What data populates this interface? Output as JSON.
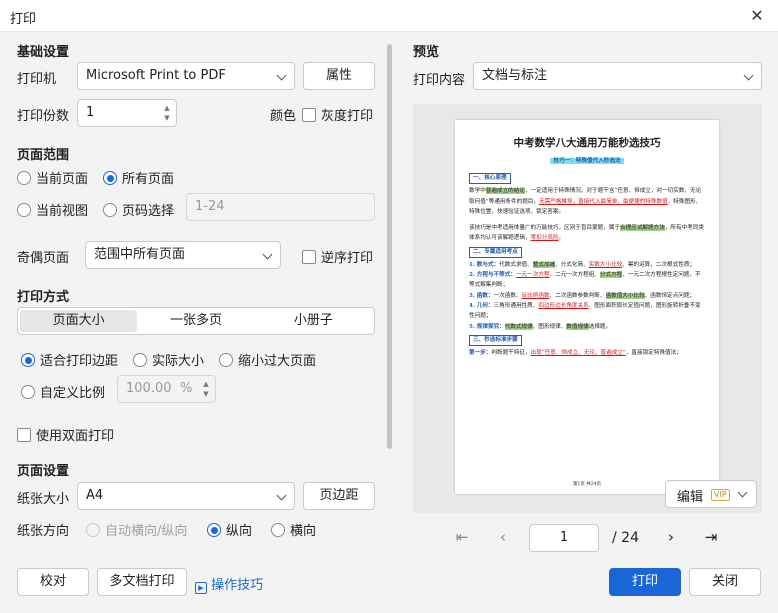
{
  "window": {
    "title": "打印",
    "close_glyph": "✕"
  },
  "basic": {
    "heading": "基础设置",
    "printer_label": "打印机",
    "printer_value": "Microsoft Print to PDF",
    "properties_button": "属性",
    "copies_label": "打印份数",
    "copies_value": "1",
    "color_label": "颜色",
    "grayscale_label": "灰度打印"
  },
  "range": {
    "heading": "页面范围",
    "current_page": "当前页面",
    "all_pages": "所有页面",
    "current_view": "当前视图",
    "page_select": "页码选择",
    "page_select_value": "1-24",
    "odd_even_label": "奇偶页面",
    "odd_even_value": "范围中所有页面",
    "reverse_label": "逆序打印"
  },
  "mode": {
    "heading": "打印方式",
    "tabs": [
      "页面大小",
      "一张多页",
      "小册子"
    ],
    "fit_margin": "适合打印边距",
    "actual_size": "实际大小",
    "shrink_large": "缩小过大页面",
    "custom_scale": "自定义比例",
    "scale_value": "100.00",
    "scale_unit": "%",
    "duplex_label": "使用双面打印"
  },
  "page_setup": {
    "heading": "页面设置",
    "paper_size_label": "纸张大小",
    "paper_size_value": "A4",
    "margins_button": "页边距",
    "orientation_label": "纸张方向",
    "auto_orientation": "自动横向/纵向",
    "portrait": "纵向",
    "landscape": "横向"
  },
  "preview": {
    "heading": "预览",
    "content_label": "打印内容",
    "content_value": "文档与标注",
    "edit_button": "编辑",
    "vip_badge": "VIP",
    "page_current": "1",
    "page_total": "/ 24"
  },
  "doc": {
    "title": "中考数学八大通用万能秒选技巧",
    "subtitle": "技巧一：特殊值代入秒选法",
    "h1": "一、核心原理",
    "p1a": "数学中",
    "p1b": "普遍成立的结论",
    "p1c": "，一定适用于特殊情况。对于题干含“任意、恒成立，对一切实数、无论取何值”等通用条件的题目，",
    "p1d": "无需严格推导，直接代入最简单、最便捷的特殊数值",
    "p1e": "，特殊图形、特殊位置，快速验证选项，锁定答案。",
    "p2a": "该技巧是中考适用体量广的万能技巧，区别于盲目蒙题，属于",
    "p2b": "合理应试解题方法",
    "p2c": "，所有中考同类体系均认可该解题逻辑，",
    "p2d": "零扣分风险",
    "p2e": "。",
    "h2": "二、专属适用考点",
    "l1a": "1. 数与式：",
    "l1b": "代数式求值、",
    "l1c": "整式加减",
    "l1d": "、分式化简、",
    "l1e": "实数大小比较",
    "l1f": "、幂的运算，二次根式性质；",
    "l2a": "2. 方程与不等式：",
    "l2b": "一元一次方程",
    "l2c": "、二元一次方程组、",
    "l2d": "分式方程",
    "l2e": "、一元二次方程根性定问题，不等式解集判断；",
    "l3a": "3. 函数：",
    "l3b": "一次函数、",
    "l3c": "反比例函数",
    "l3d": "、二次函数参数判断、",
    "l3e": "函数值大小比较",
    "l3f": "、函数恒定点问题；",
    "l4a": "4. 几何：",
    "l4b": "三角形通用性质、",
    "l4c": "四边形边长角度关系",
    "l4d": "、图形面积周长定值问题，图形旋转折叠不变性问题；",
    "l5a": "5. 规律探究：",
    "l5b": "代数式规律",
    "l5c": "、图形规律、",
    "l5d": "数值规律",
    "l5e": "选择题。",
    "h3": "三、秒选标准步骤",
    "s1a": "第一步：",
    "s1b": "判断题干特征，",
    "s1c": "出现“任意、恒成立、无论、普遍成立”",
    "s1d": "，直接锁定特殊值法；",
    "footer": "第1页 共24页"
  },
  "footer": {
    "proofread_button": "校对",
    "multi_doc_button": "多文档打印",
    "tips_link": "操作技巧",
    "print_button": "打印",
    "close_button": "关闭"
  }
}
